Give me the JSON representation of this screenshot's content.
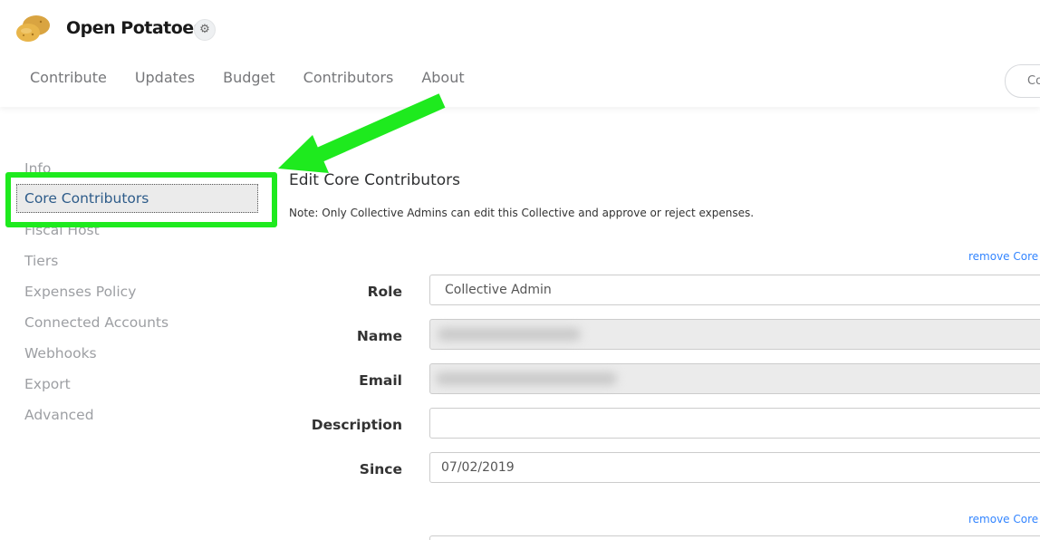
{
  "header": {
    "collective_name": "Open Potatoes",
    "settings_icon": "gear-icon",
    "logo_icon": "potato-logo-icon",
    "nav": [
      "Contribute",
      "Updates",
      "Budget",
      "Contributors",
      "About"
    ],
    "action_button_partial": "Co"
  },
  "sidebar": {
    "items": [
      "Info",
      "Core Contributors",
      "Fiscal Host",
      "Tiers",
      "Expenses Policy",
      "Connected Accounts",
      "Webhooks",
      "Export",
      "Advanced"
    ],
    "active": "Core Contributors"
  },
  "annotation": {
    "color": "#1eea1e"
  },
  "main": {
    "title": "Edit Core Contributors",
    "note": "Note: Only Collective Admins can edit this Collective and approve or reject expenses.",
    "remove_link": "remove Core",
    "form": {
      "role_label": "Role",
      "role_value": "Collective Admin",
      "name_label": "Name",
      "email_label": "Email",
      "description_label": "Description",
      "description_value": "",
      "since_label": "Since",
      "since_value": "07/02/2019"
    },
    "remove_link_2": "remove Core"
  },
  "colors": {
    "active_menu_text": "#2e5c8a",
    "link": "#3385ff"
  }
}
